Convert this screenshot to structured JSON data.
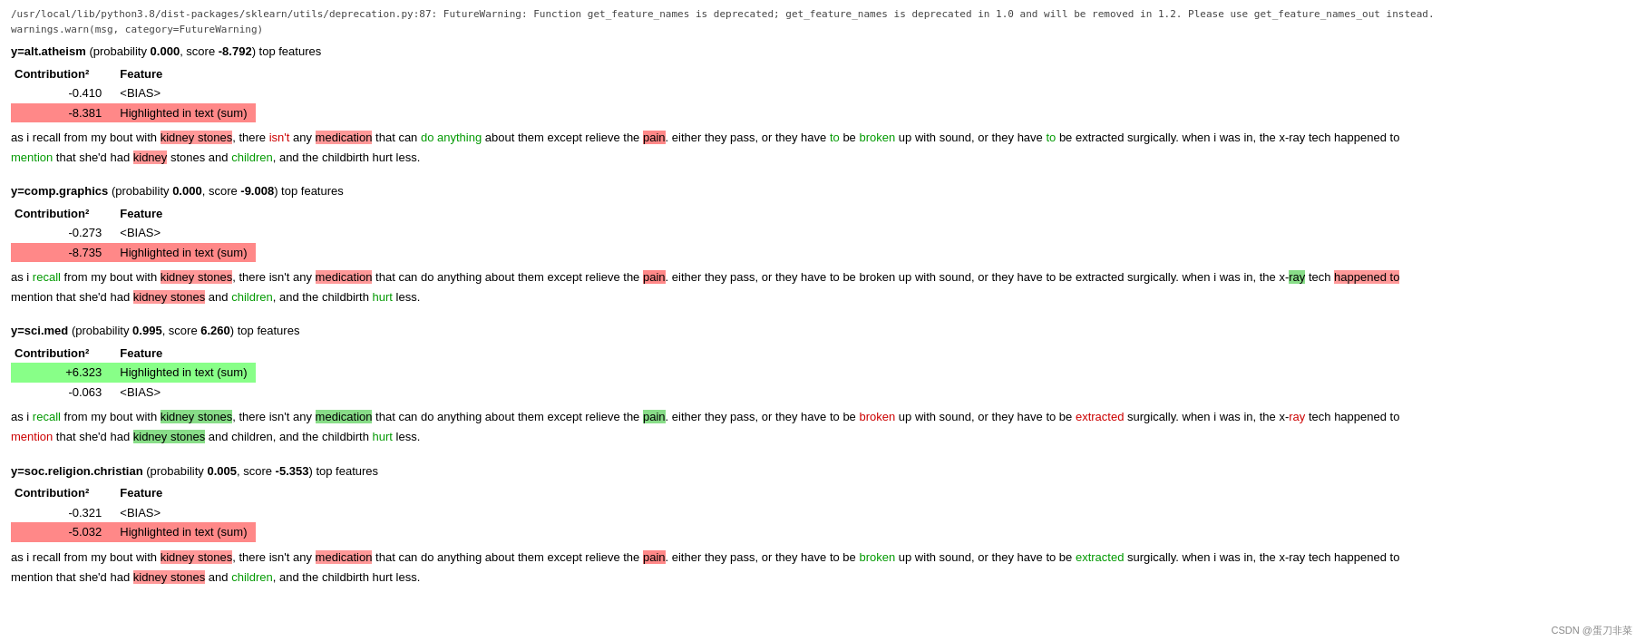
{
  "warning": {
    "line1": "/usr/local/lib/python3.8/dist-packages/sklearn/utils/deprecation.py:87: FutureWarning: Function get_feature_names is deprecated; get_feature_names is deprecated in 1.0 and will be removed in 1.2. Please use get_feature_names_out instead.",
    "line2": "  warnings.warn(msg, category=FutureWarning)"
  },
  "sections": [
    {
      "id": "alt-atheism",
      "label": "y=alt.atheism",
      "prob": "0.000",
      "score": "-8.792",
      "table": {
        "headers": [
          "Contribution²",
          "Feature"
        ],
        "rows": [
          {
            "contribution": "-0.410",
            "feature": "<BIAS>",
            "highlight": ""
          },
          {
            "contribution": "-8.381",
            "feature": "Highlighted in text (sum)",
            "highlight": "red"
          }
        ]
      },
      "text_segments": [
        {
          "text": "as i recall from my bout with ",
          "hl": ""
        },
        {
          "text": "kidney stones",
          "hl": "pink"
        },
        {
          "text": ", there ",
          "hl": ""
        },
        {
          "text": "isn't",
          "hl": "red-text"
        },
        {
          "text": " any ",
          "hl": ""
        },
        {
          "text": "medication",
          "hl": "pink"
        },
        {
          "text": " that can ",
          "hl": ""
        },
        {
          "text": "do anything",
          "hl": "green-text"
        },
        {
          "text": " about them except relieve the ",
          "hl": ""
        },
        {
          "text": "pain",
          "hl": "red"
        },
        {
          "text": ". either they pass, or they have ",
          "hl": ""
        },
        {
          "text": "to",
          "hl": "green-text"
        },
        {
          "text": " be ",
          "hl": ""
        },
        {
          "text": "broken",
          "hl": "green-text"
        },
        {
          "text": " up with sound, or they have ",
          "hl": ""
        },
        {
          "text": "to",
          "hl": "green-text"
        },
        {
          "text": " be extracted surgically. when i was in, the x-ray tech happened to",
          "hl": ""
        },
        {
          "text": "\n",
          "hl": ""
        },
        {
          "text": "mention",
          "hl": "green-text"
        },
        {
          "text": " that she'd had ",
          "hl": ""
        },
        {
          "text": "kidney",
          "hl": "pink"
        },
        {
          "text": " stones and ",
          "hl": ""
        },
        {
          "text": "children",
          "hl": "green-text"
        },
        {
          "text": ", and the childbirth hurt less.",
          "hl": ""
        }
      ]
    },
    {
      "id": "comp-graphics",
      "label": "y=comp.graphics",
      "prob": "0.000",
      "score": "-9.008",
      "table": {
        "headers": [
          "Contribution²",
          "Feature"
        ],
        "rows": [
          {
            "contribution": "-0.273",
            "feature": "<BIAS>",
            "highlight": ""
          },
          {
            "contribution": "-8.735",
            "feature": "Highlighted in text (sum)",
            "highlight": "red"
          }
        ]
      },
      "text_segments": [
        {
          "text": "as i ",
          "hl": ""
        },
        {
          "text": "recall",
          "hl": "green-text"
        },
        {
          "text": " from my bout with ",
          "hl": ""
        },
        {
          "text": "kidney stones",
          "hl": "pink"
        },
        {
          "text": ", there isn't any ",
          "hl": ""
        },
        {
          "text": "medication",
          "hl": "pink"
        },
        {
          "text": " that can do anything about them except relieve the ",
          "hl": ""
        },
        {
          "text": "pain",
          "hl": "red"
        },
        {
          "text": ". either they pass, or they have to be broken up with sound, or they have to be extracted surgically. when i was in, the x-",
          "hl": ""
        },
        {
          "text": "ray",
          "hl": "green"
        },
        {
          "text": " tech ",
          "hl": ""
        },
        {
          "text": "happened to",
          "hl": "pink"
        },
        {
          "text": "\nmention that she'd had ",
          "hl": ""
        },
        {
          "text": "kidney stones",
          "hl": "pink"
        },
        {
          "text": " and ",
          "hl": ""
        },
        {
          "text": "children",
          "hl": "green-text"
        },
        {
          "text": ", and the childbirth ",
          "hl": ""
        },
        {
          "text": "hurt",
          "hl": "green-text"
        },
        {
          "text": " less.",
          "hl": ""
        }
      ]
    },
    {
      "id": "sci-med",
      "label": "y=sci.med",
      "prob": "0.995",
      "score": "6.260",
      "table": {
        "headers": [
          "Contribution²",
          "Feature"
        ],
        "rows": [
          {
            "contribution": "+6.323",
            "feature": "Highlighted in text (sum)",
            "highlight": "green"
          },
          {
            "contribution": "-0.063",
            "feature": "<BIAS>",
            "highlight": ""
          }
        ]
      },
      "text_segments": [
        {
          "text": "as i ",
          "hl": ""
        },
        {
          "text": "recall",
          "hl": "green-text"
        },
        {
          "text": " from my bout with ",
          "hl": ""
        },
        {
          "text": "kidney stones",
          "hl": "green"
        },
        {
          "text": ", there isn't any ",
          "hl": ""
        },
        {
          "text": "medication",
          "hl": "green"
        },
        {
          "text": " that can do anything about them except relieve the ",
          "hl": ""
        },
        {
          "text": "pain",
          "hl": "green-border"
        },
        {
          "text": ". either they pass, or they have to be ",
          "hl": ""
        },
        {
          "text": "broken",
          "hl": "red-text"
        },
        {
          "text": " up with sound, or they have to be ",
          "hl": ""
        },
        {
          "text": "extracted",
          "hl": "red-text"
        },
        {
          "text": " surgically. when i was in, the x-",
          "hl": ""
        },
        {
          "text": "ray",
          "hl": "red-text"
        },
        {
          "text": " tech happened to",
          "hl": ""
        },
        {
          "text": "\n",
          "hl": ""
        },
        {
          "text": "mention",
          "hl": "red-text"
        },
        {
          "text": " that she'd had ",
          "hl": ""
        },
        {
          "text": "kidney stones",
          "hl": "green"
        },
        {
          "text": " and children, and the ",
          "hl": ""
        },
        {
          "text": "the",
          "hl": "red-text"
        },
        {
          "text": " childbirth ",
          "hl": ""
        },
        {
          "text": "hurt",
          "hl": "green-text"
        },
        {
          "text": " less.",
          "hl": ""
        }
      ]
    },
    {
      "id": "soc-religion-christian",
      "label": "y=soc.religion.christian",
      "prob": "0.005",
      "score": "-5.353",
      "table": {
        "headers": [
          "Contribution²",
          "Feature"
        ],
        "rows": [
          {
            "contribution": "-0.321",
            "feature": "<BIAS>",
            "highlight": ""
          },
          {
            "contribution": "-5.032",
            "feature": "Highlighted in text (sum)",
            "highlight": "red"
          }
        ]
      },
      "text_segments": [
        {
          "text": "as i recall from my bout with ",
          "hl": ""
        },
        {
          "text": "kidney stones",
          "hl": "pink"
        },
        {
          "text": ", there isn't any ",
          "hl": ""
        },
        {
          "text": "medication",
          "hl": "pink"
        },
        {
          "text": " that can do anything about them except relieve the ",
          "hl": ""
        },
        {
          "text": "pain",
          "hl": "red"
        },
        {
          "text": ". either they pass, or they have to be ",
          "hl": ""
        },
        {
          "text": "broken",
          "hl": "green-text"
        },
        {
          "text": " up with sound, or they have to be ",
          "hl": ""
        },
        {
          "text": "extracted",
          "hl": "green-text"
        },
        {
          "text": " surgically. when i was in, the x-ray tech happened to",
          "hl": ""
        },
        {
          "text": "\nmention that she'd had ",
          "hl": ""
        },
        {
          "text": "kidney stones",
          "hl": "pink"
        },
        {
          "text": " and ",
          "hl": ""
        },
        {
          "text": "children",
          "hl": "green-text"
        },
        {
          "text": ", and the childbirth hurt less.",
          "hl": ""
        }
      ]
    }
  ],
  "watermark": "CSDN @蛋刀非菜"
}
